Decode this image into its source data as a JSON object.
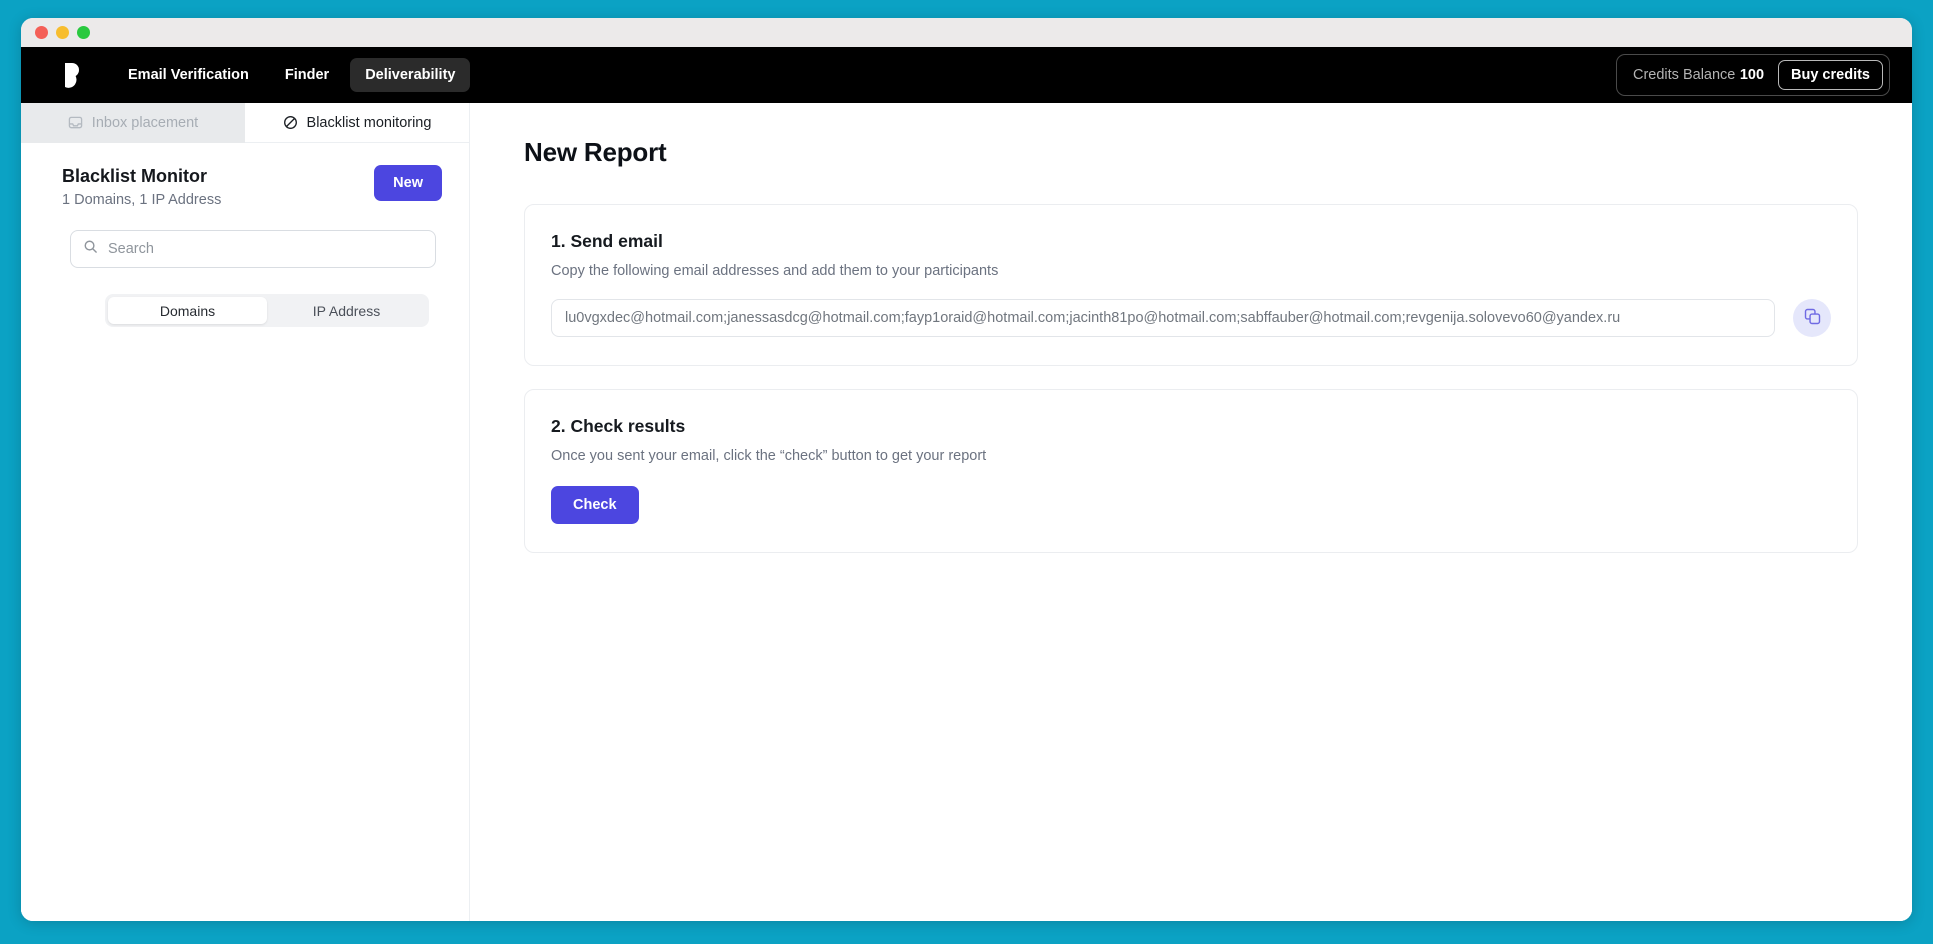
{
  "window": {
    "traffic_lights": [
      "close",
      "minimize",
      "maximize"
    ]
  },
  "topnav": {
    "logo_name": "bouncer-logo",
    "links": [
      {
        "label": "Email Verification",
        "active": false
      },
      {
        "label": "Finder",
        "active": false
      },
      {
        "label": "Deliverability",
        "active": true
      }
    ],
    "credits_label": "Credits Balance",
    "credits_value": "100",
    "buy_credits_label": "Buy credits"
  },
  "sidebar": {
    "subtabs": [
      {
        "label": "Inbox placement",
        "icon": "inbox-icon",
        "active": false
      },
      {
        "label": "Blacklist monitoring",
        "icon": "ban-icon",
        "active": true
      }
    ],
    "panel_title": "Blacklist Monitor",
    "panel_subtitle": "1 Domains, 1 IP Address",
    "new_button_label": "New",
    "search": {
      "value": "",
      "placeholder": "Search",
      "icon": "search-icon"
    },
    "segmented": [
      {
        "label": "Domains",
        "active": true
      },
      {
        "label": "IP Address",
        "active": false
      }
    ]
  },
  "main": {
    "page_title": "New Report",
    "cards": [
      {
        "title": "1. Send email",
        "desc": "Copy the following email addresses and add them to your participants",
        "emails_value": "lu0vgxdec@hotmail.com;janessasdcg@hotmail.com;fayp1oraid@hotmail.com;jacinth81po@hotmail.com;sabffauber@hotmail.com;revgenija.solovevo60@yandex.ru",
        "copy_icon": "copy-icon"
      },
      {
        "title": "2. Check results",
        "desc": "Once you sent your email, click the “check” button to get your report",
        "check_label": "Check"
      }
    ]
  },
  "colors": {
    "desktop_background": "#0BA2C4",
    "accent_purple": "#4C46E0",
    "nav_background": "#000000",
    "copy_button_background": "#e5e7fb"
  }
}
